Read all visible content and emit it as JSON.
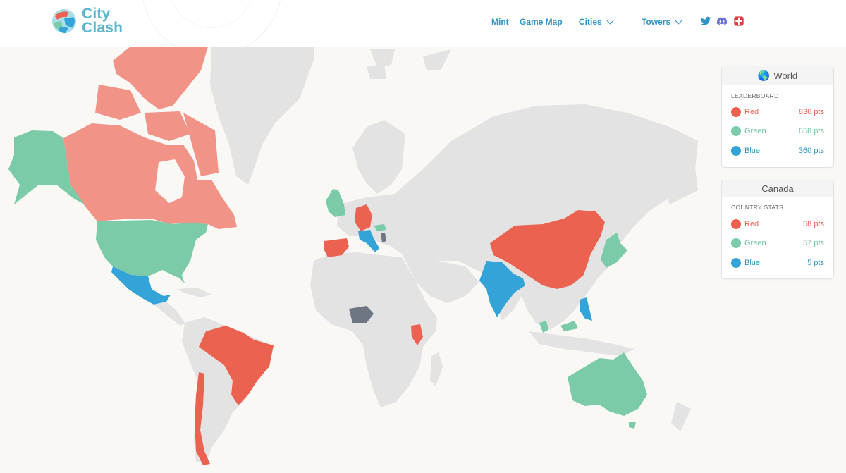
{
  "brand": {
    "line1": "City",
    "line2": "Clash",
    "logo_icon": "city-clash-globe-logo"
  },
  "nav": {
    "mint": "Mint",
    "game_map": "Game Map",
    "cities": "Cities",
    "towers": "Towers",
    "social_icons": [
      "twitter-icon",
      "discord-icon",
      "opensea-icon"
    ]
  },
  "colors": {
    "red": "#ec6251",
    "salmon": "#f19487",
    "green": "#7bcba8",
    "blue": "#34a4d8",
    "slate": "#6e7583",
    "land": "#e3e3e3",
    "accent": "#2f95c8"
  },
  "world_panel": {
    "title": "World",
    "subtitle": "LEADERBOARD",
    "teams": [
      {
        "name": "Red",
        "points": "836 pts",
        "color": "#ec6251"
      },
      {
        "name": "Green",
        "points": "658 pts",
        "color": "#7bcba8"
      },
      {
        "name": "Blue",
        "points": "360 pts",
        "color": "#34a4d8"
      }
    ]
  },
  "country_panel": {
    "title": "Canada",
    "subtitle": "COUNTRY STATS",
    "teams": [
      {
        "name": "Red",
        "points": "58 pts",
        "color": "#ec6251"
      },
      {
        "name": "Green",
        "points": "57 pts",
        "color": "#7bcba8"
      },
      {
        "name": "Blue",
        "points": "5 pts",
        "color": "#34a4d8"
      }
    ]
  }
}
